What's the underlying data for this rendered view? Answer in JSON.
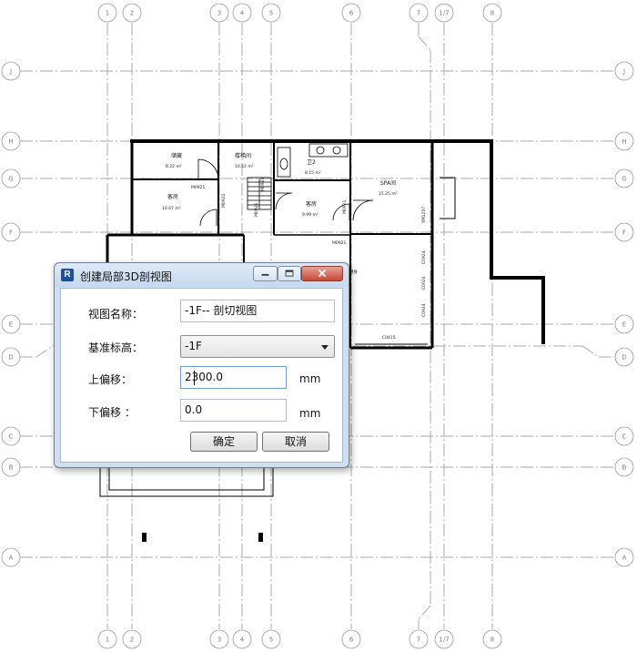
{
  "grid": {
    "columns": [
      "1",
      "2",
      "3",
      "4",
      "5",
      "6",
      "7",
      "1/7",
      "8"
    ],
    "rows": [
      "J",
      "H",
      "G",
      "F",
      "E",
      "D",
      "C",
      "B",
      "A"
    ]
  },
  "rooms": [
    {
      "name": "储藏",
      "area": "8.22 m²"
    },
    {
      "name": "楼梯间",
      "area": "10.22 m²"
    },
    {
      "name": "卫2",
      "area": "8.15 m²"
    },
    {
      "name": "SPA间",
      "area": "15.25 m²"
    },
    {
      "name": "客房",
      "area": "10.07 m²"
    },
    {
      "name": "客房",
      "area": "9.99 m²"
    }
  ],
  "plan_tags": {
    "door1": "M0921",
    "door2": "M0921",
    "door3": "M0921",
    "door4": "M0921",
    "door5": "M0921",
    "door6": "M0921",
    "window1": "YM1257",
    "window2": "C0924",
    "window3": "C0924",
    "window4": "C0924",
    "window5": "C0415",
    "partial": "健身"
  },
  "dialog": {
    "title": "创建局部3D剖视图",
    "view_name_label": "视图名称：",
    "view_name_value": "-1F-- 剖切视图",
    "base_level_label": "基准标高：",
    "base_level_value": "-1F",
    "upper_offset_label": "上偏移：",
    "upper_offset_value": "2300.0",
    "lower_offset_label": "下偏移 ：",
    "lower_offset_value": "0.0",
    "unit_upper": "mm",
    "unit_lower": "mm",
    "ok_label": "确定",
    "cancel_label": "取消"
  },
  "icons": {
    "app": "revit-app-icon",
    "minimize": "minimize-icon",
    "maximize": "maximize-icon",
    "close": "close-icon",
    "dropdown": "chevron-down-icon"
  }
}
